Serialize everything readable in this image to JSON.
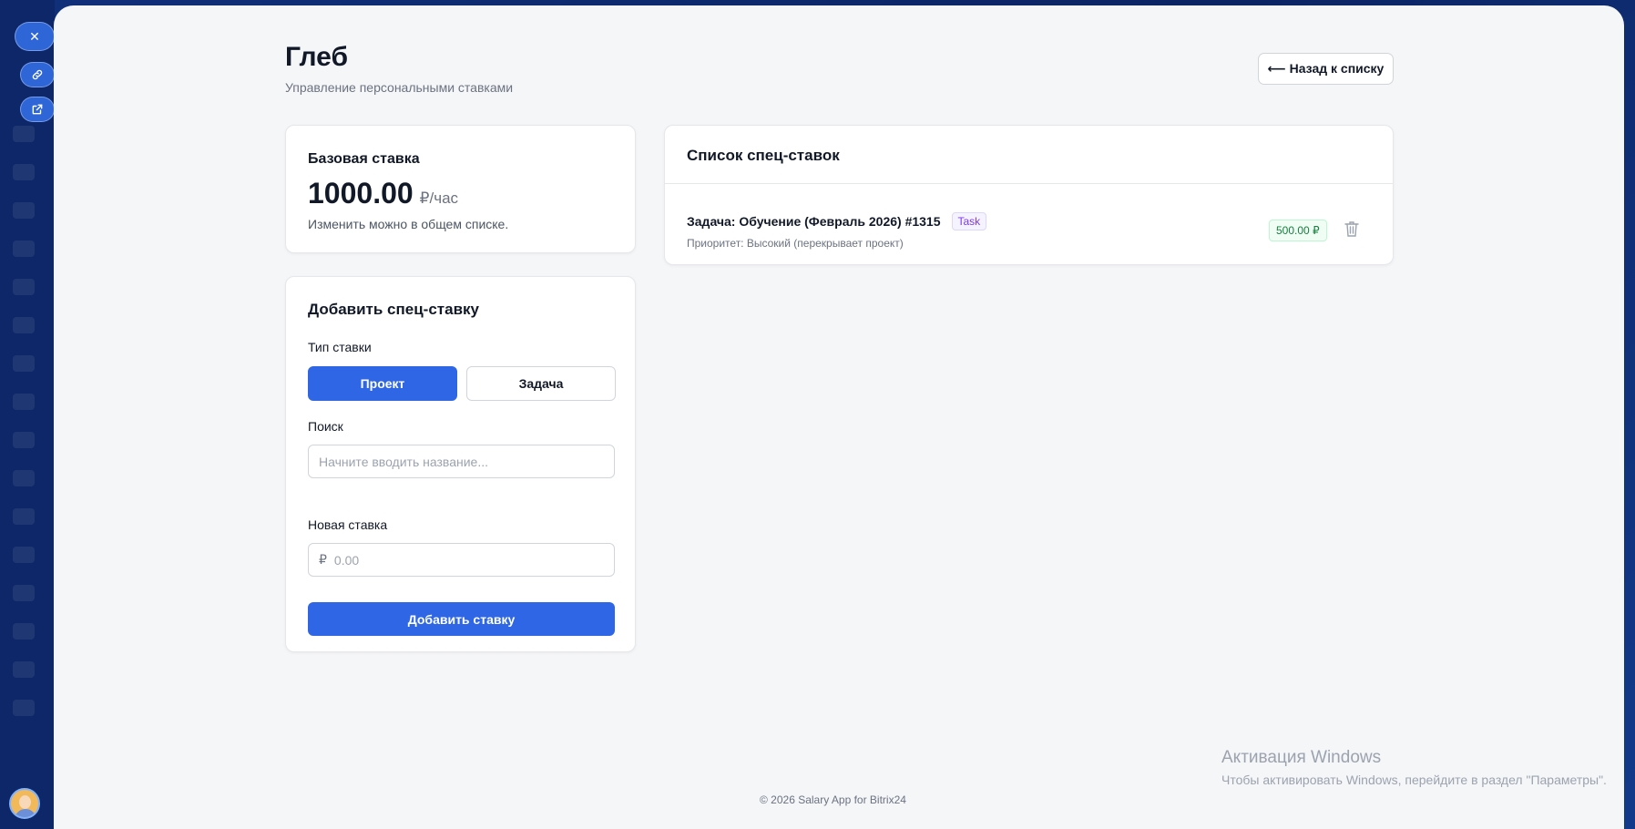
{
  "page": {
    "title": "Глеб",
    "subtitle": "Управление персональными ставками",
    "back_button": "⟵ Назад к списку"
  },
  "base_rate": {
    "label": "Базовая ставка",
    "value": "1000.00",
    "unit": "₽/час",
    "note": "Изменить можно в общем списке."
  },
  "add_form": {
    "title": "Добавить спец-ставку",
    "type_label": "Тип ставки",
    "type_options": [
      "Проект",
      "Задача"
    ],
    "type_selected": "Проект",
    "search_label": "Поиск",
    "search_placeholder": "Начните вводить название...",
    "rate_label": "Новая ставка",
    "currency_symbol": "₽",
    "rate_placeholder": "0.00",
    "submit_label": "Добавить ставку"
  },
  "rates_list": {
    "title": "Список спец-ставок",
    "items": [
      {
        "name": "Задача: Обучение (Февраль 2026) #1315",
        "badge": "Task",
        "priority": "Приоритет: Высокий (перекрывает проект)",
        "amount": "500.00 ₽"
      }
    ]
  },
  "footer": "© 2026 Salary App for Bitrix24",
  "windows_activation": {
    "title": "Активация Windows",
    "subtitle": "Чтобы активировать Windows, перейдите в раздел \"Параметры\"."
  },
  "colors": {
    "primary": "#2f66e6",
    "badge_purple": "#7c3aed",
    "amount_green": "#15803d"
  }
}
